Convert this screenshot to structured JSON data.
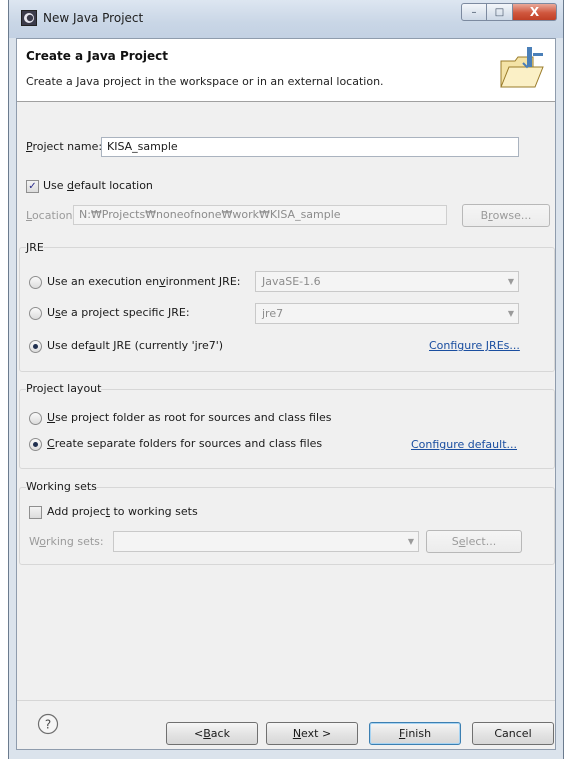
{
  "window": {
    "title": "New Java Project",
    "minimize_glyph": "–",
    "maximize_glyph": "□",
    "close_glyph": "X"
  },
  "header": {
    "title": "Create a Java Project",
    "description": "Create a Java project in the workspace or in an external location."
  },
  "project_name": {
    "label_prefix": "",
    "label_hot": "P",
    "label_rest": "roject name:",
    "value": "KISA_sample"
  },
  "default_location": {
    "checked": true,
    "check_glyph": "✓",
    "label_pre": "Use ",
    "label_hot": "d",
    "label_rest": "efault location"
  },
  "location": {
    "label_hot": "L",
    "label_rest": "ocation:",
    "value": "N:₩Projects₩noneofnone₩work₩KISA_sample",
    "browse_pre": "B",
    "browse_hot": "r",
    "browse_rest": "owse..."
  },
  "jre": {
    "title": "JRE",
    "opt1_pre": "Use an execution en",
    "opt1_hot": "v",
    "opt1_rest": "ironment JRE:",
    "opt1_value": "JavaSE-1.6",
    "opt2_pre": "U",
    "opt2_hot": "s",
    "opt2_rest": "e a project specific JRE:",
    "opt2_value": "jre7",
    "opt3_pre": "Use def",
    "opt3_hot": "a",
    "opt3_rest": "ult JRE (currently 'jre7')",
    "selected": 3,
    "configure_pre": "Configure JREs...",
    "arrow_glyph": "▼"
  },
  "layout": {
    "title": "Project layout",
    "opt1_hot": "U",
    "opt1_rest": "se project folder as root for sources and class files",
    "opt2_hot": "C",
    "opt2_rest": "reate separate folders for sources and class files",
    "selected": 2,
    "configure": "Configure default..."
  },
  "working_sets": {
    "title": "Working sets",
    "checkbox_pre": "Add projec",
    "checkbox_hot": "t",
    "checkbox_rest": " to working sets",
    "checked": false,
    "label_pre": "W",
    "label_hot": "o",
    "label_rest": "rking sets:",
    "select_pre": "S",
    "select_hot": "e",
    "select_rest": "lect..."
  },
  "footer": {
    "help_glyph": "?",
    "back_pre": "< ",
    "back_hot": "B",
    "back_rest": "ack",
    "next_hot": "N",
    "next_rest": "ext >",
    "finish_hot": "F",
    "finish_rest": "inish",
    "cancel": "Cancel"
  }
}
